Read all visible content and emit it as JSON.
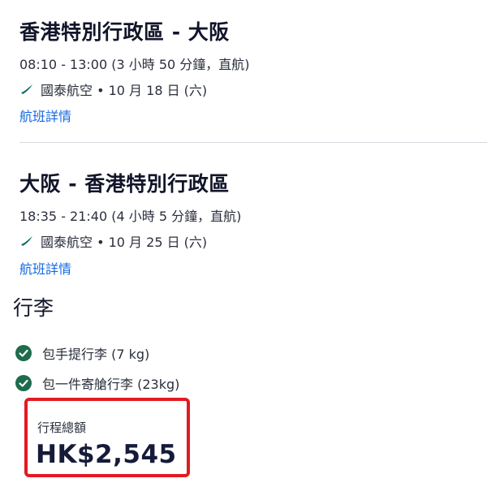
{
  "outbound": {
    "route": "香港特別行政區 - 大阪",
    "time": "08:10 - 13:00 (3 小時 50 分鐘，直航)",
    "airline_date": "國泰航空 • 10 月 18 日 (六)",
    "details_link": "航班詳情"
  },
  "inbound": {
    "route": "大阪 - 香港特別行政區",
    "time": "18:35 - 21:40 (4 小時 5 分鐘，直航)",
    "airline_date": "國泰航空 • 10 月 25 日 (六)",
    "details_link": "航班詳情"
  },
  "baggage": {
    "title": "行李",
    "items": [
      {
        "label": "包手提行李 (7 kg)"
      },
      {
        "label": "包一件寄艙行李 (23kg)"
      }
    ]
  },
  "total": {
    "label": "行程總額",
    "price": "HK$2,545"
  },
  "colors": {
    "link": "#1668e3",
    "check": "#1e6b4d",
    "highlight": "#e21a21",
    "airline_logo": "#0b6e63"
  },
  "icons": {
    "airline_logo": "cathay-pacific-logo-icon",
    "included": "check-circle-icon"
  }
}
